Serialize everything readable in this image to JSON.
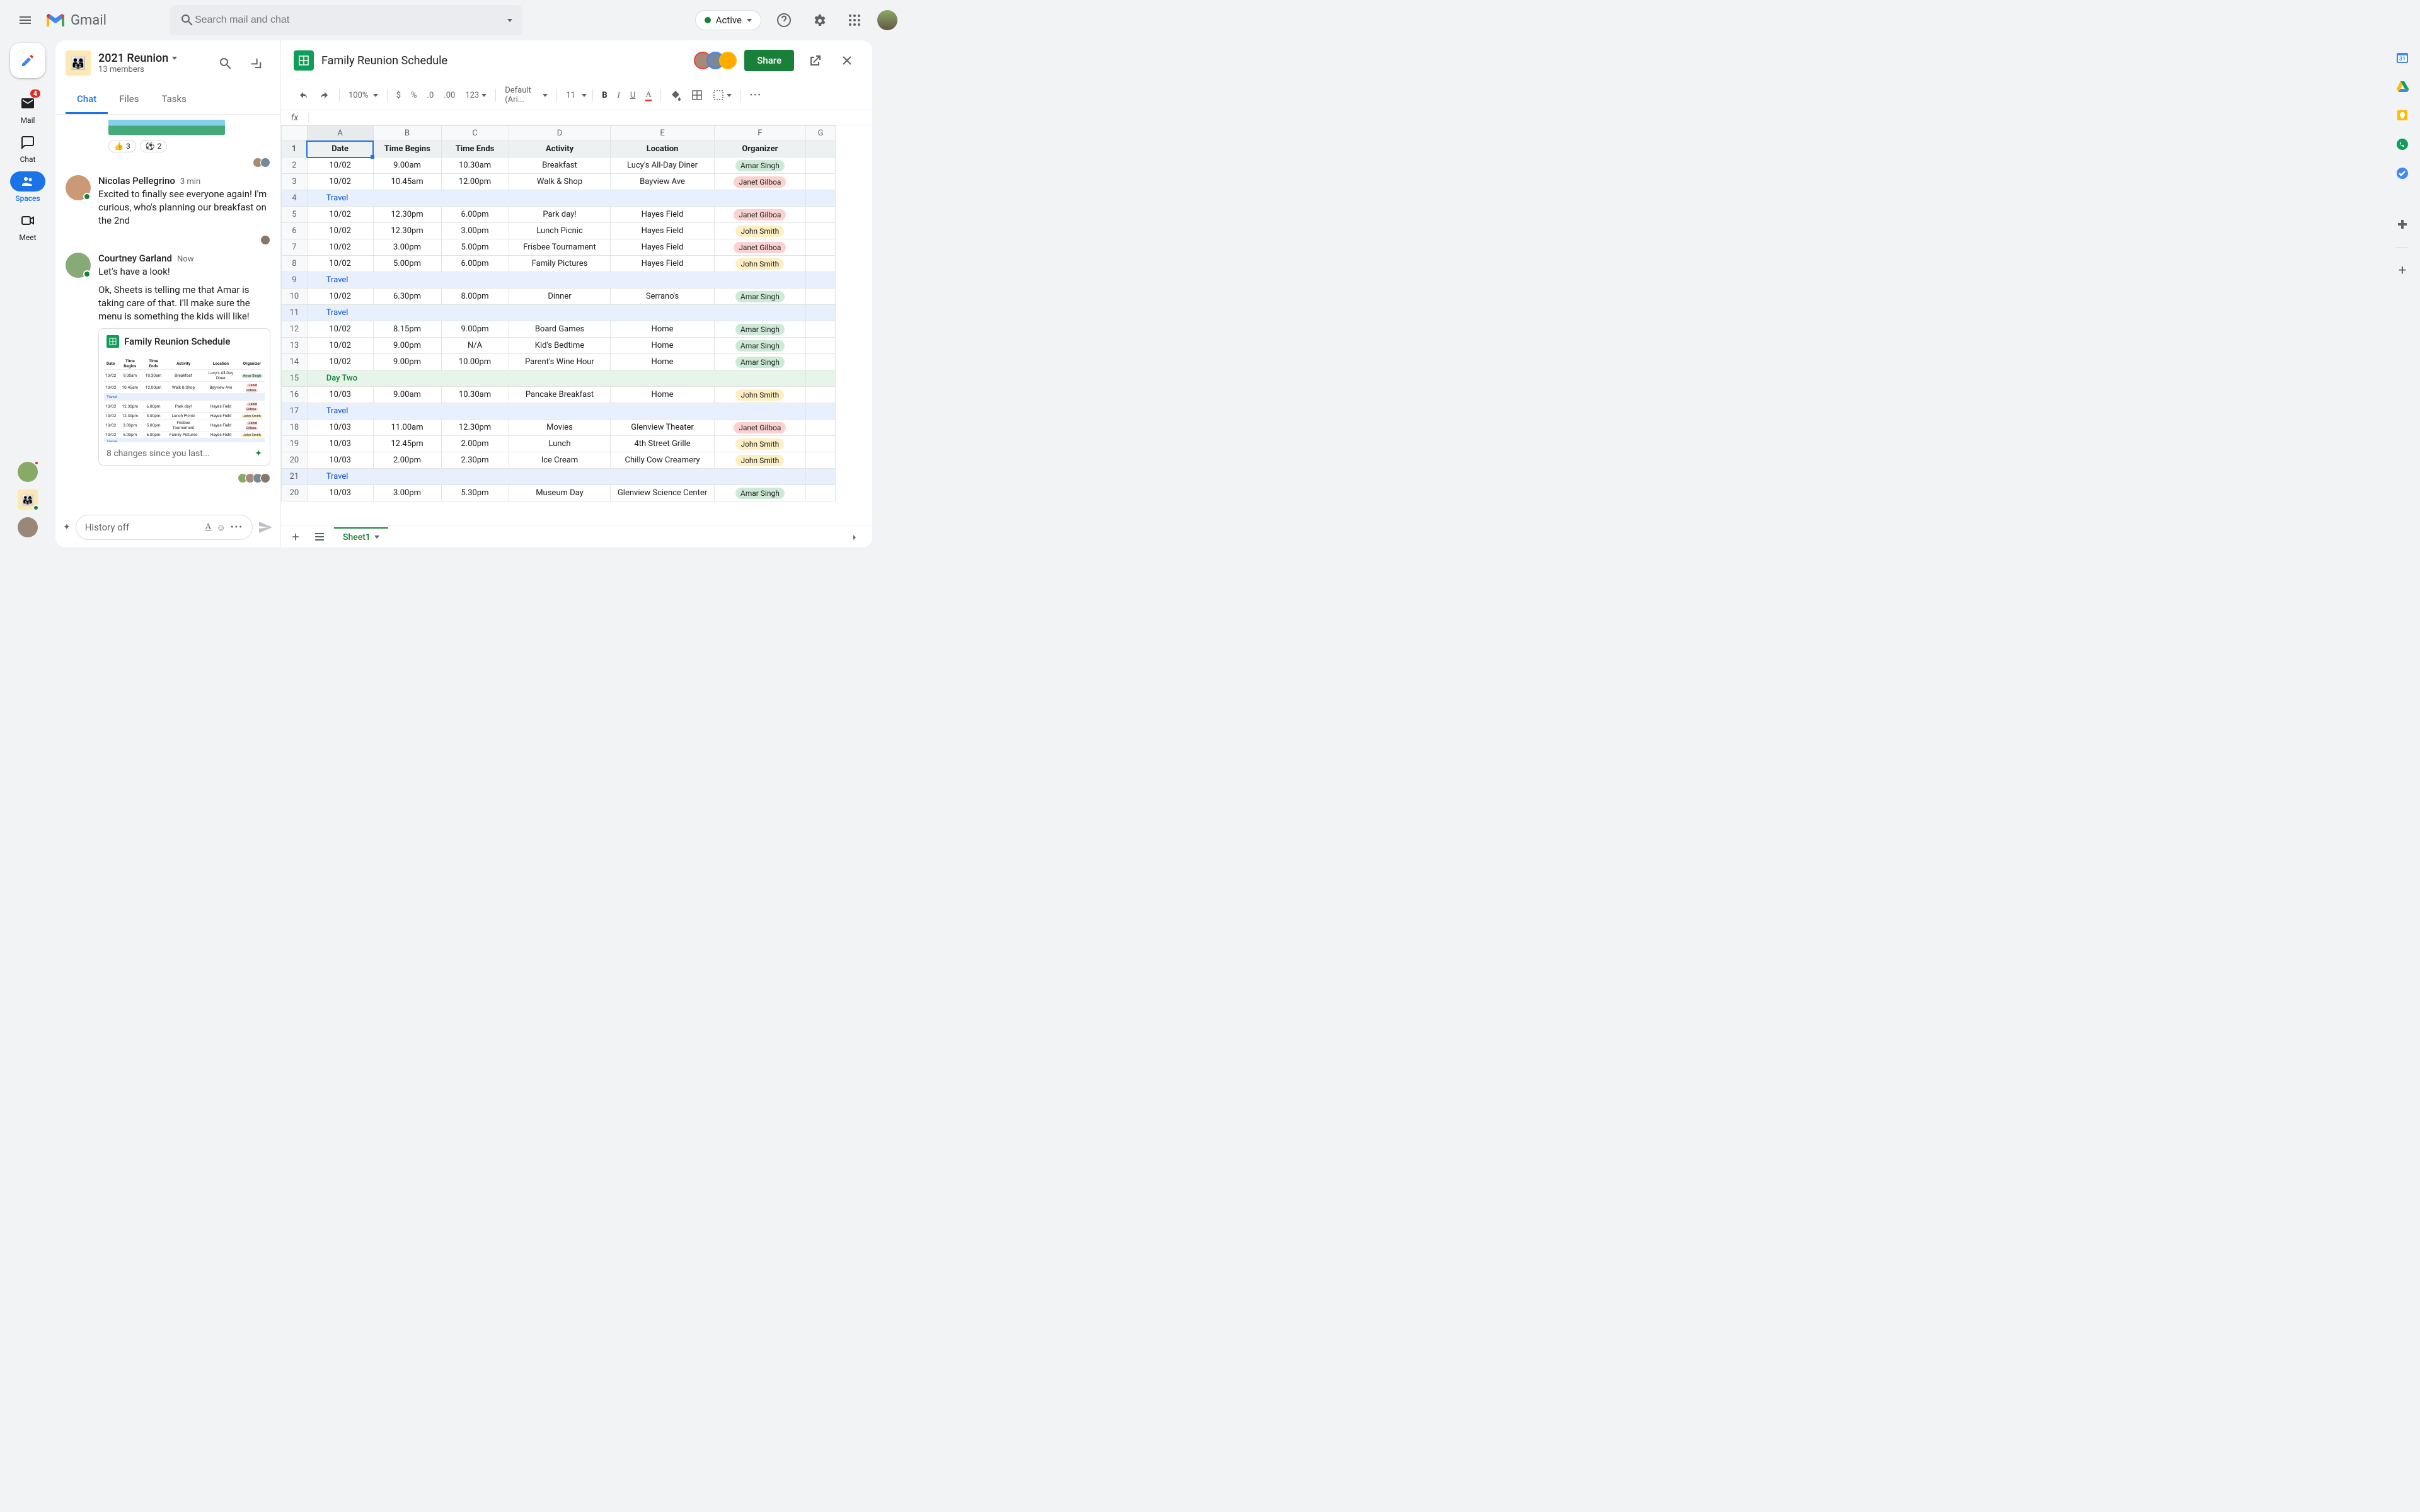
{
  "app": {
    "name": "Gmail"
  },
  "search": {
    "placeholder": "Search mail and chat"
  },
  "active_status": "Active",
  "rail": {
    "mail": {
      "label": "Mail",
      "badge": "4"
    },
    "chat": {
      "label": "Chat"
    },
    "spaces": {
      "label": "Spaces"
    },
    "meet": {
      "label": "Meet"
    }
  },
  "space": {
    "name": "2021 Reunion",
    "members": "13 members",
    "tabs": {
      "chat": "Chat",
      "files": "Files",
      "tasks": "Tasks"
    }
  },
  "reactions": [
    {
      "emoji": "👍",
      "count": "3"
    },
    {
      "emoji": "⚽",
      "count": "2"
    }
  ],
  "messages": {
    "m1": {
      "author": "Nicolas Pellegrino",
      "time": "3 min",
      "text": "Excited to finally see everyone again! I'm curious, who's planning our breakfast on the 2nd"
    },
    "m2": {
      "author": "Courtney Garland",
      "time": "Now",
      "text1": "Let's have a look!",
      "text2": "Ok, Sheets is telling me that Amar is taking care of that. I'll make sure the menu is something the kids will like!"
    }
  },
  "preview": {
    "title": "Family Reunion Schedule",
    "footer": "8 changes since you last..."
  },
  "compose": {
    "placeholder": "History off"
  },
  "sheet": {
    "title": "Family Reunion Schedule",
    "share": "Share",
    "zoom": "100%",
    "font": "Default (Ari...",
    "size": "11",
    "num_fmt": "123",
    "tab_name": "Sheet1",
    "cols": [
      "A",
      "B",
      "C",
      "D",
      "E",
      "F",
      "G"
    ],
    "headers": {
      "date": "Date",
      "begins": "Time Begins",
      "ends": "Time Ends",
      "activity": "Activity",
      "location": "Location",
      "organizer": "Organizer"
    },
    "rows": [
      {
        "n": 1,
        "type": "header"
      },
      {
        "n": 2,
        "type": "normal",
        "date": "10/02",
        "begins": "9.00am",
        "ends": "10.30am",
        "activity": "Breakfast",
        "location": "Lucy's All-Day Diner",
        "organizer": "Amar Singh",
        "org": "amar"
      },
      {
        "n": 3,
        "type": "normal",
        "date": "10/02",
        "begins": "10.45am",
        "ends": "12.00pm",
        "activity": "Walk & Shop",
        "location": "Bayview Ave",
        "organizer": "Janet Gilboa",
        "org": "janet"
      },
      {
        "n": 4,
        "type": "travel",
        "label": "Travel"
      },
      {
        "n": 5,
        "type": "normal",
        "date": "10/02",
        "begins": "12.30pm",
        "ends": "6.00pm",
        "activity": "Park day!",
        "location": "Hayes Field",
        "organizer": "Janet Gilboa",
        "org": "janet"
      },
      {
        "n": 6,
        "type": "normal",
        "date": "10/02",
        "begins": "12.30pm",
        "ends": "3.00pm",
        "activity": "Lunch Picnic",
        "location": "Hayes Field",
        "organizer": "John Smith",
        "org": "john"
      },
      {
        "n": 7,
        "type": "normal",
        "date": "10/02",
        "begins": "3.00pm",
        "ends": "5.00pm",
        "activity": "Frisbee Tournament",
        "location": "Hayes Field",
        "organizer": "Janet Gilboa",
        "org": "janet"
      },
      {
        "n": 8,
        "type": "normal",
        "date": "10/02",
        "begins": "5.00pm",
        "ends": "6.00pm",
        "activity": "Family Pictures",
        "location": "Hayes Field",
        "organizer": "John Smith",
        "org": "john"
      },
      {
        "n": 9,
        "type": "travel",
        "label": "Travel"
      },
      {
        "n": 10,
        "type": "normal",
        "date": "10/02",
        "begins": "6.30pm",
        "ends": "8.00pm",
        "activity": "Dinner",
        "location": "Serrano's",
        "organizer": "Amar Singh",
        "org": "amar"
      },
      {
        "n": 11,
        "type": "travel",
        "label": "Travel"
      },
      {
        "n": 12,
        "type": "normal",
        "date": "10/02",
        "begins": "8.15pm",
        "ends": "9.00pm",
        "activity": "Board Games",
        "location": "Home",
        "organizer": "Amar Singh",
        "org": "amar"
      },
      {
        "n": 13,
        "type": "normal",
        "date": "10/02",
        "begins": "9.00pm",
        "ends": "N/A",
        "activity": "Kid's Bedtime",
        "location": "Home",
        "organizer": "Amar Singh",
        "org": "amar"
      },
      {
        "n": 14,
        "type": "normal",
        "date": "10/02",
        "begins": "9.00pm",
        "ends": "10.00pm",
        "activity": "Parent's Wine Hour",
        "location": "Home",
        "organizer": "Amar Singh",
        "org": "amar"
      },
      {
        "n": 15,
        "type": "day",
        "label": "Day Two"
      },
      {
        "n": 16,
        "type": "normal",
        "date": "10/03",
        "begins": "9.00am",
        "ends": "10.30am",
        "activity": "Pancake Breakfast",
        "location": "Home",
        "organizer": "John Smith",
        "org": "john"
      },
      {
        "n": 17,
        "type": "travel",
        "label": "Travel"
      },
      {
        "n": 18,
        "type": "normal",
        "date": "10/03",
        "begins": "11.00am",
        "ends": "12.30pm",
        "activity": "Movies",
        "location": "Glenview Theater",
        "organizer": "Janet Gilboa",
        "org": "janet"
      },
      {
        "n": 19,
        "type": "normal",
        "date": "10/03",
        "begins": "12.45pm",
        "ends": "2.00pm",
        "activity": "Lunch",
        "location": "4th Street Grille",
        "organizer": "John Smith",
        "org": "john"
      },
      {
        "n": 20,
        "type": "normal",
        "date": "10/03",
        "begins": "2.00pm",
        "ends": "2.30pm",
        "activity": "Ice Cream",
        "location": "Chilly Cow Creamery",
        "organizer": "John Smith",
        "org": "john"
      },
      {
        "n": 21,
        "type": "travel",
        "label": "Travel"
      },
      {
        "n": 20,
        "dup": true,
        "type": "normal",
        "date": "10/03",
        "begins": "3.00pm",
        "ends": "5.30pm",
        "activity": "Museum Day",
        "location": "Glenview Science Center",
        "organizer": "Amar Singh",
        "org": "amar"
      }
    ]
  }
}
